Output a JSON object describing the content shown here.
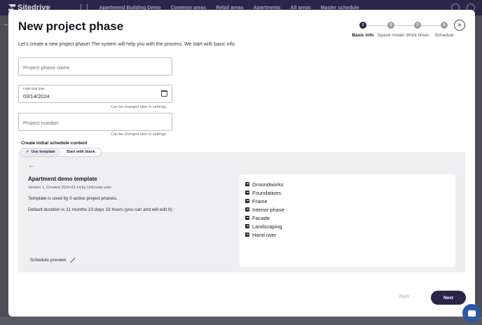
{
  "app": {
    "logo_text": "Sitedrive",
    "nav": [
      "Apartmend Building Demo",
      "Common areas",
      "Retail areas",
      "Apartments",
      "All areas",
      "Master schedule"
    ]
  },
  "modal": {
    "title": "New project phase",
    "subtitle": "Let's create a new project phase! The system will help you with the process. We start with basic info.",
    "close_icon": "×",
    "steps": [
      {
        "num": "1",
        "label": "Basic info",
        "active": true
      },
      {
        "num": "2",
        "label": "Space model",
        "active": false
      },
      {
        "num": "3",
        "label": "Work times",
        "active": false
      },
      {
        "num": "4",
        "label": "Schedule",
        "active": false
      }
    ],
    "fields": {
      "phase_name_placeholder": "Project phase name",
      "start_date_label": "Initial start date",
      "start_date_value": "03/14/2024",
      "start_date_hint": "Can be changed later in settings.",
      "project_number_placeholder": "Project number",
      "project_number_hint": "Can be changed later in settings."
    },
    "schedule_content": {
      "label": "Create initial schedule content",
      "tab_template": "Use template",
      "tab_blank": "Start with blank",
      "tab_check": "✓"
    },
    "template": {
      "back_arrow": "←",
      "name": "Apartment demo template",
      "meta": "Version 1, Created 2024-03-14 by Unknown user",
      "used_by": "Template is used by 0 active project phases.",
      "duration": "Default duration is 11 months 23 days 19 hours (you can and will edit it).",
      "preview_label": "Schedule preview",
      "phases": [
        "Groundworks",
        "Foundations",
        "Frame",
        "Interior phase",
        "Facade",
        "Landscaping",
        "Hand over"
      ]
    },
    "buttons": {
      "back": "Back",
      "next": "Next"
    }
  }
}
